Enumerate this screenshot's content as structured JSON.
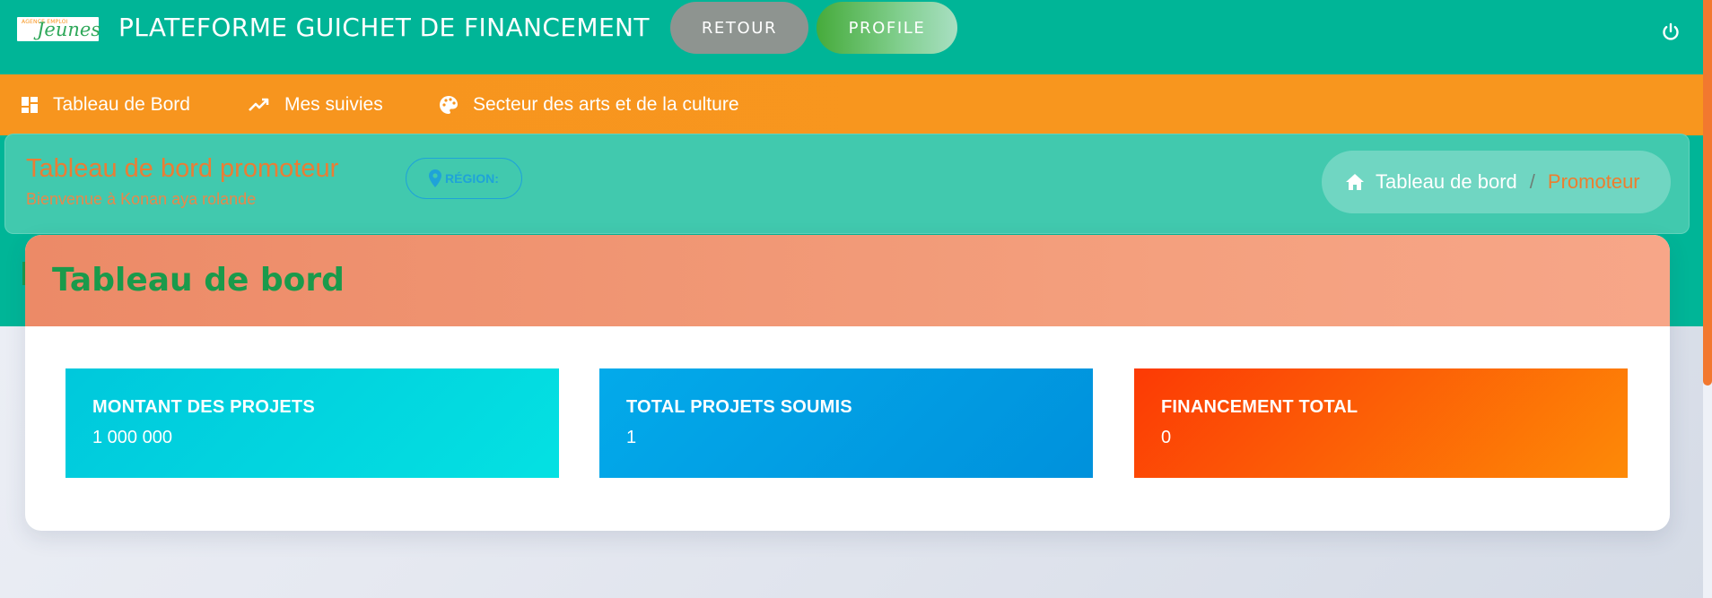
{
  "header": {
    "logo": {
      "line1": "AGENCE EMPLOI",
      "line2": "Jeunes"
    },
    "title": "PLATEFORME GUICHET DE FINANCEMENT",
    "retour_label": "RETOUR",
    "profile_label": "PROFILE",
    "power_icon": "power-icon"
  },
  "nav": {
    "items": [
      {
        "label": "Tableau de Bord",
        "icon": "dashboard-icon"
      },
      {
        "label": "Mes suivies",
        "icon": "trending-up-icon"
      },
      {
        "label": "Secteur des arts et de la culture",
        "icon": "palette-icon"
      }
    ]
  },
  "page_header": {
    "title": "Tableau de bord promoteur",
    "subtitle": "Bienvenue à Konan aya rolande",
    "region_label": "RÉGION:",
    "breadcrumb": {
      "home": "Tableau de bord",
      "separator": "/",
      "current": "Promoteur"
    }
  },
  "dashboard": {
    "title": "Tableau de bord",
    "stats": [
      {
        "label": "MONTANT DES PROJETS",
        "value": "1 000 000",
        "color": "#00c8dc"
      },
      {
        "label": "TOTAL PROJETS SOUMIS",
        "value": "1",
        "color": "#03aaea"
      },
      {
        "label": "FINANCEMENT TOTAL",
        "value": "0",
        "color": "#fc3a05"
      }
    ]
  },
  "colors": {
    "header_green": "#00b597",
    "nav_orange": "#f7951e",
    "accent_orange": "#ea7d35",
    "title_green": "#1a9a4b"
  }
}
